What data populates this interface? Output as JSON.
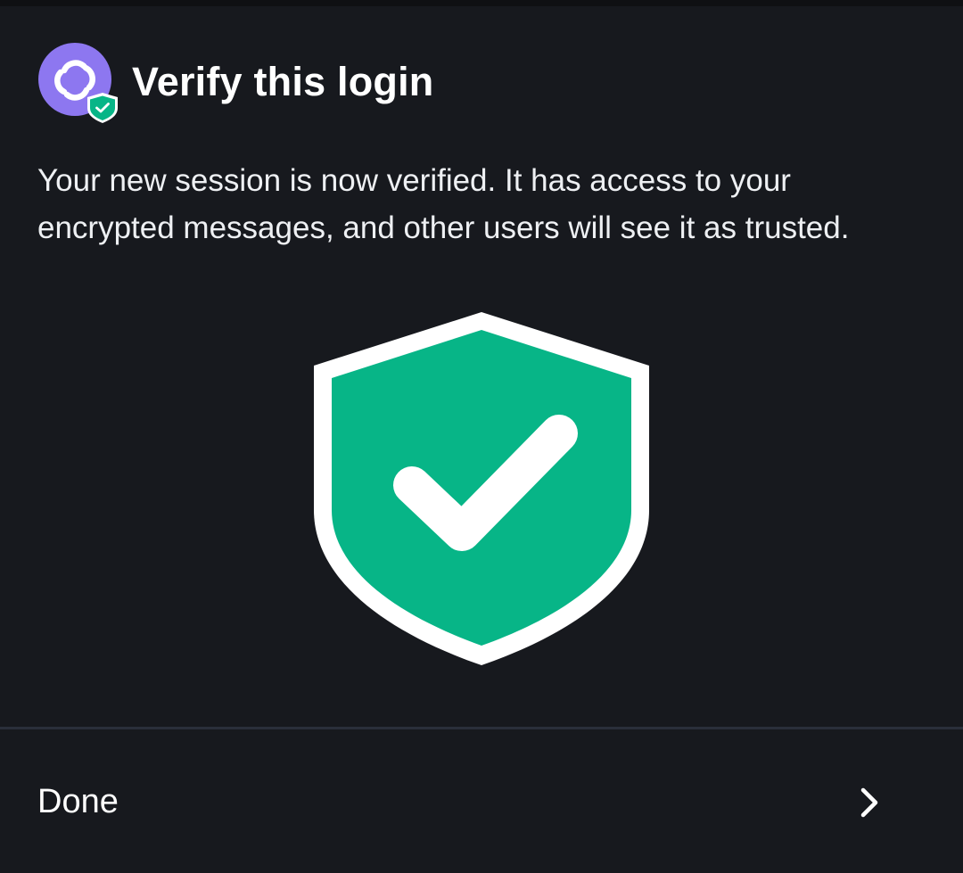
{
  "header": {
    "title": "Verify this login",
    "logo_icon": "element-logo-icon",
    "badge_icon": "verified-shield-badge-icon"
  },
  "description": "Your new session is now verified. It has access to your encrypted messages, and other users will see it as trusted.",
  "illustration": {
    "icon": "verified-shield-checkmark-icon"
  },
  "action": {
    "label": "Done",
    "icon": "chevron-right-icon"
  },
  "colors": {
    "background": "#17191e",
    "accent_green": "#07b587",
    "logo_purple": "#8d77f0",
    "divider": "#2a2f3a",
    "text": "#ffffff"
  }
}
